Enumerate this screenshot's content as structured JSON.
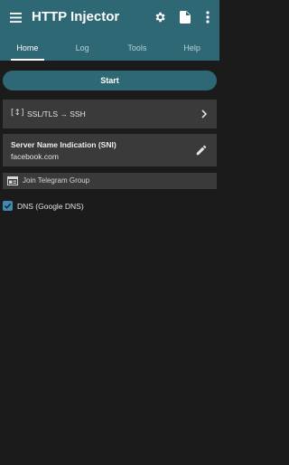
{
  "app": {
    "title": "HTTP Injector"
  },
  "toolbar": {
    "menu_icon": "hamburger-menu-icon",
    "actions": [
      "gear-icon",
      "file-icon",
      "more-vert-icon"
    ]
  },
  "tabs": [
    {
      "label": "Home",
      "active": true
    },
    {
      "label": "Log",
      "active": false
    },
    {
      "label": "Tools",
      "active": false
    },
    {
      "label": "Help",
      "active": false
    }
  ],
  "main": {
    "start_label": "Start",
    "mode": {
      "icon_text": "[↕]",
      "label": "SSL/TLS → SSH"
    },
    "sni": {
      "label": "Server Name Indication (SNI)",
      "value": "facebook.com"
    },
    "telegram": {
      "label": "Join Telegram Group"
    },
    "dns": {
      "label": "DNS (Google DNS)",
      "checked": true
    }
  },
  "colors": {
    "accent": "#2f6875",
    "background": "#1b1b1b",
    "card": "#3a3a3a",
    "checkbox": "#3d8bb0"
  }
}
